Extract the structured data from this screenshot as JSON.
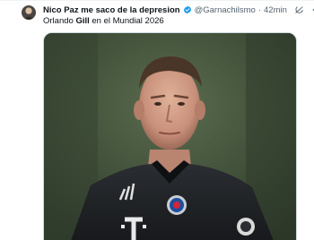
{
  "tweet": {
    "display_name": "Nico Paz me saco de la depresion",
    "handle": "@Garnachilsmo",
    "separator": "·",
    "time": "42min",
    "text_before": "Orlando ",
    "text_bold": "Gill",
    "text_after": " en el Mundial 2026"
  },
  "icons": {
    "verified": "verified-badge-icon",
    "grok": "grok-icon",
    "more": "more-icon"
  },
  "colors": {
    "verified": "#1d9bf0",
    "name": "#0f1419",
    "secondary": "#536471"
  }
}
